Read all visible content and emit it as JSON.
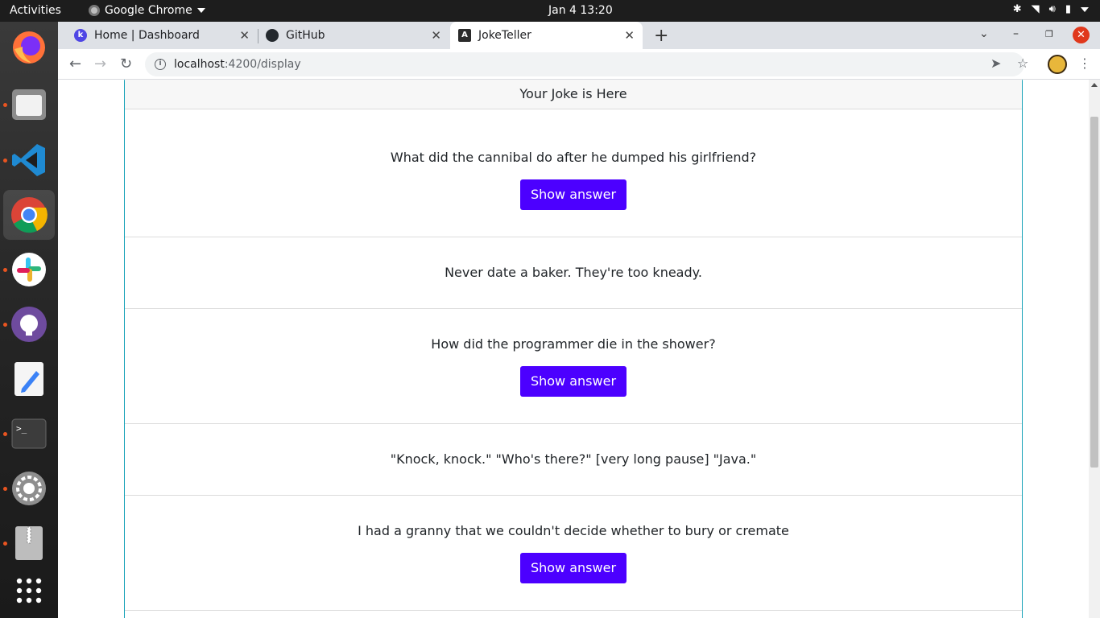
{
  "topbar": {
    "activities": "Activities",
    "app_name": "Google Chrome",
    "clock": "Jan 4  13:20"
  },
  "dock": {
    "items": [
      "firefox",
      "files",
      "vscode",
      "chrome",
      "slack",
      "github-desktop",
      "text-editor",
      "terminal",
      "settings",
      "archive-manager",
      "show-applications"
    ]
  },
  "browser": {
    "tabs": [
      {
        "title": "Home | Dashboard",
        "favicon": "k-icon"
      },
      {
        "title": "GitHub",
        "favicon": "github-icon"
      },
      {
        "title": "JokeTeller",
        "favicon": "angular-icon"
      }
    ],
    "url_host": "localhost",
    "url_path": ":4200/display"
  },
  "page": {
    "header": "Your Joke is Here",
    "jokes": [
      {
        "text": "What did the cannibal do after he dumped his girlfriend?",
        "button": "Show answer"
      },
      {
        "text": "Never date a baker. They're too kneady."
      },
      {
        "text": "How did the programmer die in the shower?",
        "button": "Show answer"
      },
      {
        "text": "\"Knock, knock.\" \"Who's there?\" [very long pause] \"Java.\""
      },
      {
        "text": "I had a granny that we couldn't decide whether to bury or cremate",
        "button": "Show answer"
      }
    ]
  },
  "colors": {
    "accent_button": "#4c00ff",
    "card_border": "#17a2b8",
    "ubuntu_orange": "#e95420"
  }
}
